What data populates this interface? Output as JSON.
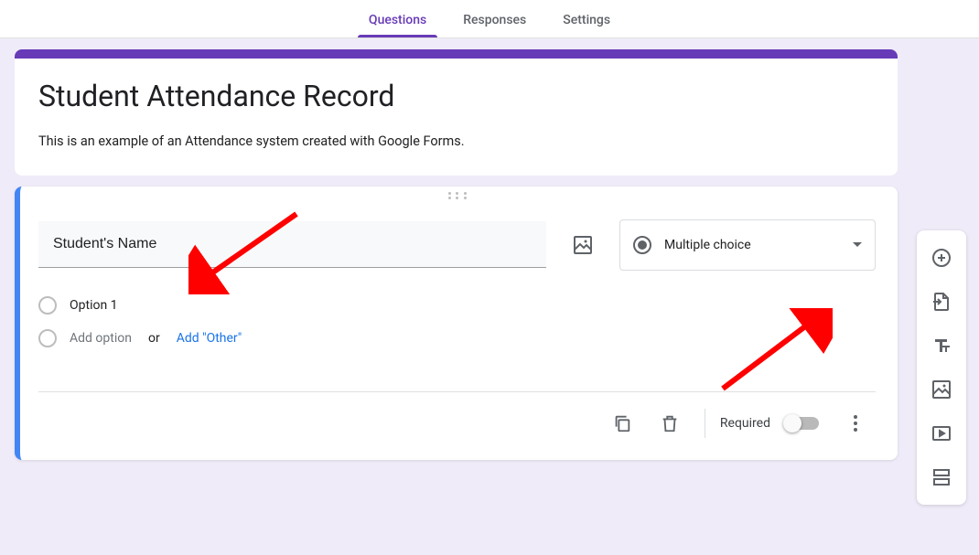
{
  "tabs": {
    "questions": "Questions",
    "responses": "Responses",
    "settings": "Settings"
  },
  "form": {
    "title": "Student Attendance Record",
    "description": "This is an example of an Attendance system created with Google Forms."
  },
  "question": {
    "title": "Student's Name",
    "type_label": "Multiple choice",
    "option1": "Option 1",
    "add_option": "Add option",
    "or": "or",
    "add_other": "Add \"Other\"",
    "required_label": "Required"
  },
  "toolbar": {
    "add_question": "Add question",
    "import_questions": "Import questions",
    "add_title": "Add title and description",
    "add_image": "Add image",
    "add_video": "Add video",
    "add_section": "Add section"
  },
  "colors": {
    "accent": "#673ab7",
    "active_border": "#4285f4",
    "link": "#1a73e8",
    "arrow": "#ff0000"
  }
}
